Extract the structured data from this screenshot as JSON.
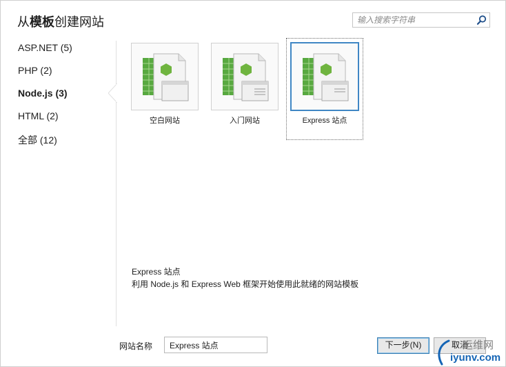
{
  "dialog": {
    "title_prefix": "从",
    "title_bold": "模板",
    "title_suffix": "创建网站"
  },
  "search": {
    "placeholder": "输入搜索字符串",
    "icon": "search-icon"
  },
  "sidebar": {
    "items": [
      {
        "label": "ASP.NET (5)",
        "active": false
      },
      {
        "label": "PHP (2)",
        "active": false
      },
      {
        "label": "Node.js (3)",
        "active": true
      },
      {
        "label": "HTML (2)",
        "active": false
      },
      {
        "label": "全部 (12)",
        "active": false
      }
    ]
  },
  "templates": [
    {
      "label": "空白网站",
      "selected": false
    },
    {
      "label": "入门网站",
      "selected": false
    },
    {
      "label": "Express 站点",
      "selected": true
    }
  ],
  "description": {
    "title": "Express 站点",
    "text": "利用 Node.js 和 Express Web 框架开始使用此就绪的网站模板"
  },
  "form": {
    "site_name_label": "网站名称",
    "site_name_value": "Express 站点"
  },
  "buttons": {
    "next": "下一步(N)",
    "cancel": "取消"
  },
  "watermark": {
    "line1": "运维网",
    "line2": "iyunv.com"
  },
  "colors": {
    "accent": "#3f86c4",
    "node_green": "#6fb43f",
    "sheet_green": "#58a940"
  }
}
